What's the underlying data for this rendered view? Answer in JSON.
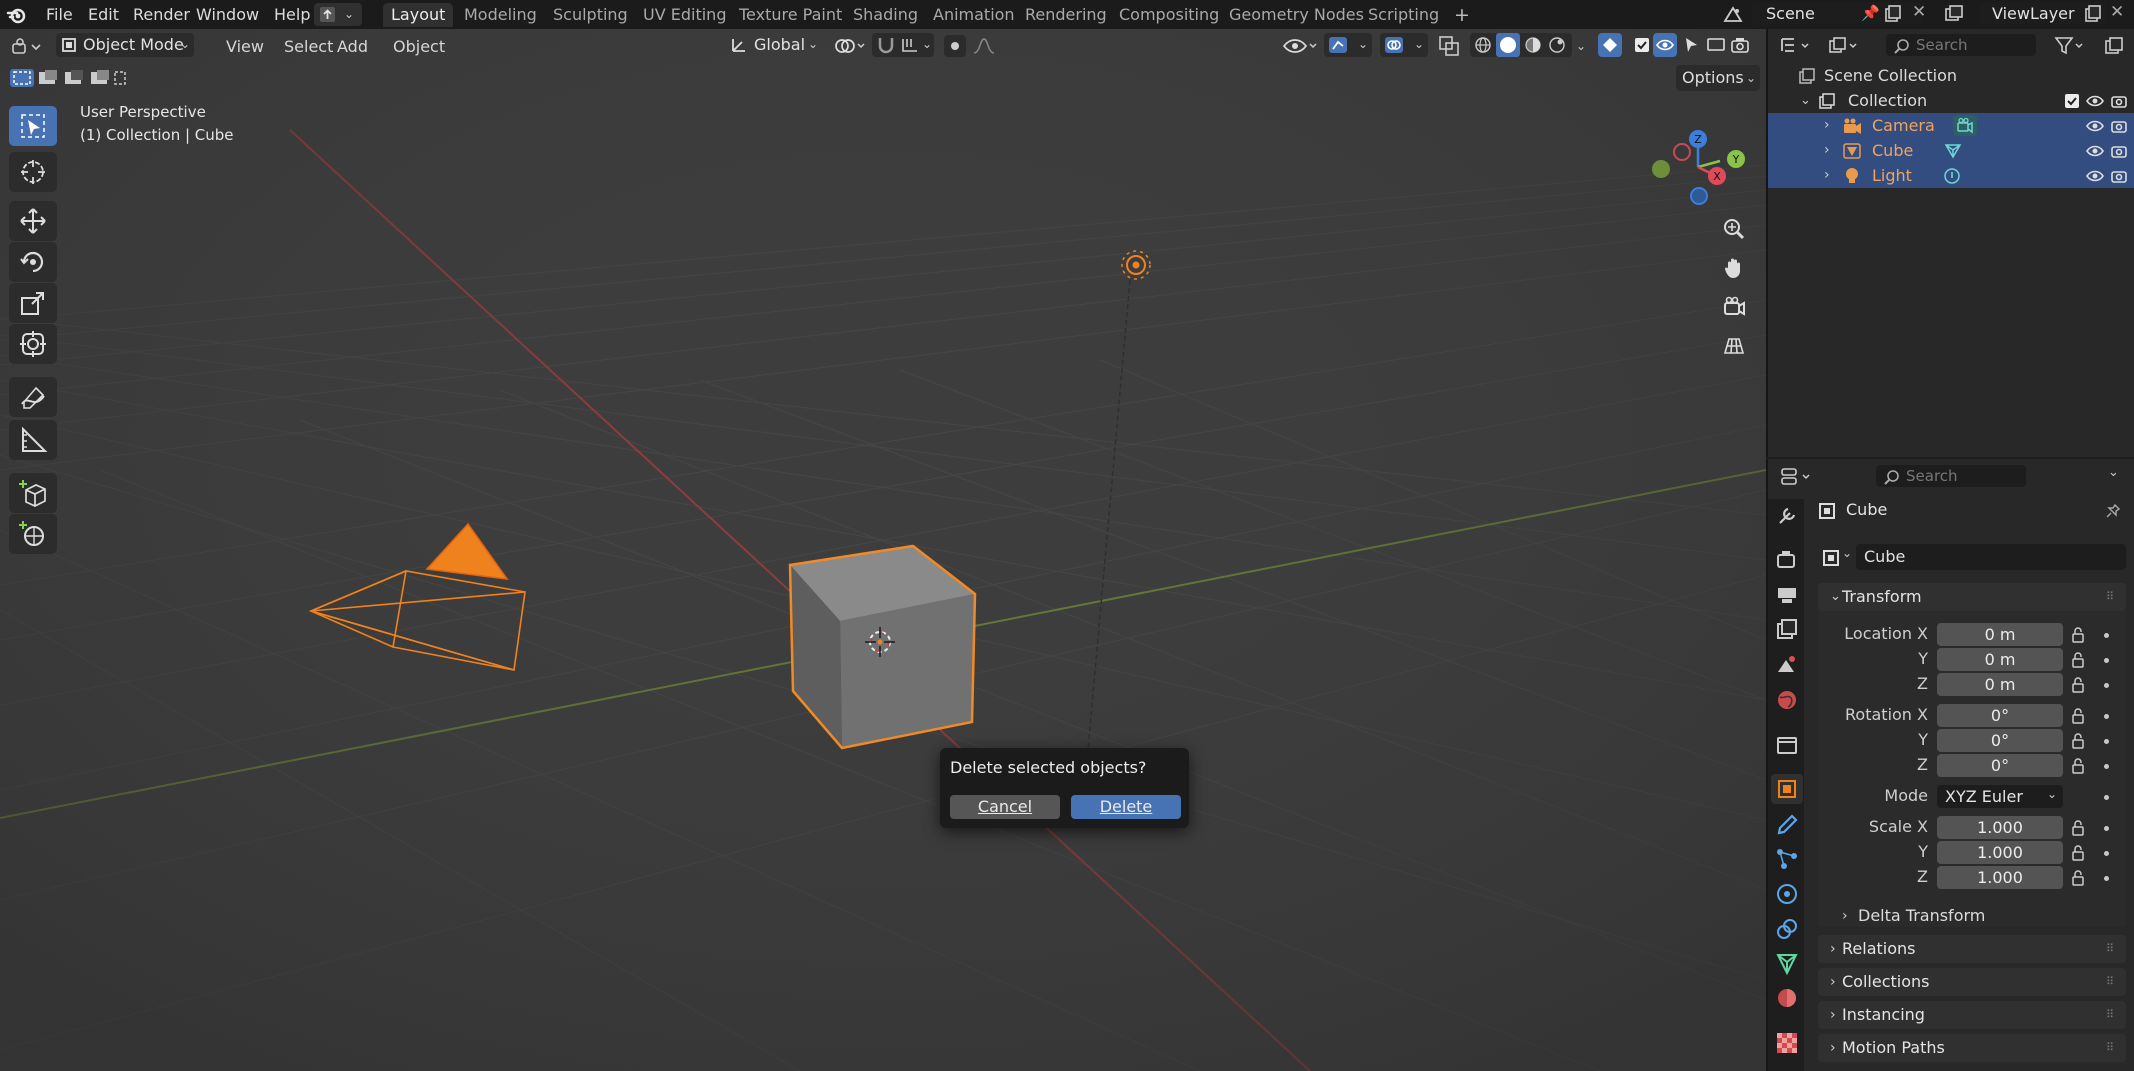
{
  "topbar": {
    "menus": [
      "File",
      "Edit",
      "Render",
      "Window",
      "Help"
    ],
    "workspaces": [
      "Layout",
      "Modeling",
      "Sculpting",
      "UV Editing",
      "Texture Paint",
      "Shading",
      "Animation",
      "Rendering",
      "Compositing",
      "Geometry Nodes",
      "Scripting"
    ],
    "active_workspace": "Layout",
    "add_workspace": "+",
    "scene": "Scene",
    "view_layer": "ViewLayer"
  },
  "viewport_header": {
    "mode": "Object Mode",
    "menus": [
      "View",
      "Select",
      "Add",
      "Object"
    ],
    "orientation": "Global",
    "options": "Options"
  },
  "overlay": {
    "perspective": "User Perspective",
    "context": "(1) Collection | Cube"
  },
  "gizmo": {
    "x": "X",
    "y": "Y",
    "z": "Z"
  },
  "tools": [
    "select-box-icon",
    "cursor-icon",
    "move-icon",
    "rotate-icon",
    "scale-icon",
    "transform-icon",
    "annotate-icon",
    "measure-icon",
    "add-cube-icon",
    "add-mesh-icon"
  ],
  "dialog": {
    "title": "Delete selected objects?",
    "cancel": "Cancel",
    "delete": "Delete"
  },
  "outliner": {
    "search_placeholder": "Search",
    "scene_collection": "Scene Collection",
    "collection": "Collection",
    "items": [
      {
        "name": "Camera",
        "selected": true
      },
      {
        "name": "Cube",
        "selected": true
      },
      {
        "name": "Light",
        "selected": true
      }
    ]
  },
  "properties": {
    "search_placeholder": "Search",
    "object_name": "Cube",
    "datablock_name": "Cube",
    "transform_title": "Transform",
    "location_label": "Location X",
    "rotation_label": "Rotation X",
    "scale_label": "Scale X",
    "y_label": "Y",
    "z_label": "Z",
    "location": [
      "0 m",
      "0 m",
      "0 m"
    ],
    "rotation": [
      "0°",
      "0°",
      "0°"
    ],
    "mode_label": "Mode",
    "mode_value": "XYZ Euler",
    "scale": [
      "1.000",
      "1.000",
      "1.000"
    ],
    "panels": [
      "Delta Transform",
      "Relations",
      "Collections",
      "Instancing",
      "Motion Paths"
    ]
  },
  "colors": {
    "accent": "#4772b3",
    "selection_orange": "#f0821e",
    "x_axis": "#e04a5a",
    "y_axis": "#8bc34a",
    "z_axis": "#3b7fdb"
  }
}
